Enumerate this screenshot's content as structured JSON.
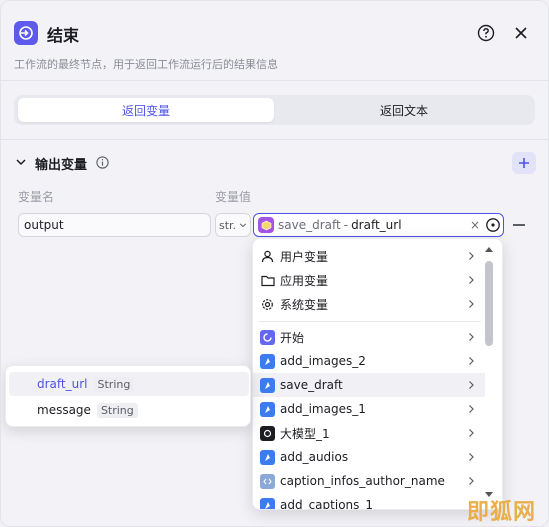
{
  "header": {
    "title": "结束",
    "description": "工作流的最终节点，用于返回工作流运行后的结果信息"
  },
  "tabs": [
    {
      "label": "返回变量",
      "active": true
    },
    {
      "label": "返回文本",
      "active": false
    }
  ],
  "section": {
    "title": "输出变量"
  },
  "columns": {
    "name_label": "变量名",
    "value_label": "变量值"
  },
  "row": {
    "name_value": "output",
    "type_short": "str.",
    "ref_node": "save_draft",
    "ref_separator": "-",
    "ref_variable": "draft_url",
    "clear_glyph": "×"
  },
  "dropdown": {
    "items": [
      {
        "label": "用户变量",
        "icon": "user-icon"
      },
      {
        "label": "应用变量",
        "icon": "folder-icon"
      },
      {
        "label": "系统变量",
        "icon": "gear-icon"
      },
      {
        "label": "开始",
        "icon": "start-node-icon"
      },
      {
        "label": "add_images_2",
        "icon": "plugin-icon"
      },
      {
        "label": "save_draft",
        "icon": "plugin-icon",
        "hover": true
      },
      {
        "label": "add_images_1",
        "icon": "plugin-icon"
      },
      {
        "label": "大模型_1",
        "icon": "llm-icon"
      },
      {
        "label": "add_audios",
        "icon": "plugin-icon"
      },
      {
        "label": "caption_infos_author_name",
        "icon": "code-icon"
      },
      {
        "label": "add_captions_1",
        "icon": "plugin-icon"
      }
    ]
  },
  "subpanel": {
    "items": [
      {
        "name": "draft_url",
        "type": "String",
        "selected": true
      },
      {
        "name": "message",
        "type": "String",
        "selected": false
      }
    ]
  },
  "watermark": "即狐网",
  "colors": {
    "accent": "#4d53e8",
    "node_icon": "#5e5bec",
    "plugin_tile": "#3d7cf0",
    "save_draft_tile": "#a454e8",
    "start_tile": "#6468f0"
  }
}
